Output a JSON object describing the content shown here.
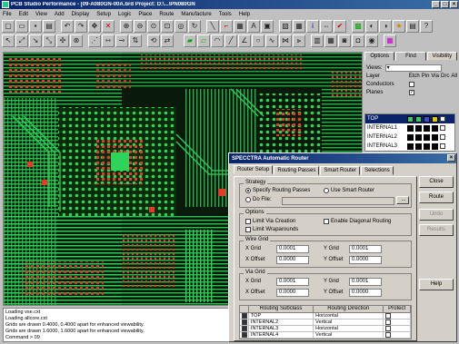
{
  "window": {
    "title": "PCB Studio Performance - [09-A080GN-00A.brd  Project: D:\\...\\PN080GN"
  },
  "menu": [
    "File",
    "Edit",
    "View",
    "Add",
    "Display",
    "Setup",
    "Logic",
    "Place",
    "Route",
    "Manufacture",
    "Tools",
    "Help"
  ],
  "panel": {
    "tabs": [
      "Options",
      "Find",
      "Visibility"
    ],
    "views_label": "Views:",
    "layer_label": "Layer",
    "col_headers": [
      "Etch",
      "Pin",
      "Via",
      "Drc",
      "All"
    ],
    "conductors_label": "Conductors",
    "planes_label": "Planes",
    "layers": [
      {
        "name": "TOP",
        "color": "#33cc66"
      },
      {
        "name": "INTERNAL1",
        "color": "#000000"
      },
      {
        "name": "INTERNAL2",
        "color": "#000000"
      },
      {
        "name": "INTERNAL3",
        "color": "#000000"
      }
    ]
  },
  "status": [
    "Loading vse.cxt",
    "Loading allcore.cxt",
    "Grids are drawn 0.4000, 0.4000 apart for enhanced viewability.",
    "Grids are drawn 1.6000, 1.6000 apart for enhanced viewability.",
    "Command > 09"
  ],
  "dialog": {
    "title": "SPECCTRA Automatic Router",
    "tabs": [
      "Router Setup",
      "Routing Passes",
      "Smart Router",
      "Selections"
    ],
    "strategy_label": "Strategy",
    "specify_label": "Specify Routing Passes",
    "smart_label": "Use Smart Router",
    "dofile_label": "Do File:",
    "browse_label": "...",
    "options_label": "Options",
    "limit_via_label": "Limit Via Creation",
    "diagonal_label": "Enable Diagonal Routing",
    "wraparounds_label": "Limit Wraparounds",
    "wire_grid_label": "Wire Grid",
    "via_grid_label": "Via Grid",
    "xgrid_label": "X Grid",
    "ygrid_label": "Y Grid",
    "xoffset_label": "X Offset",
    "yoffset_label": "Y Offset",
    "wire": {
      "xgrid": "0.0001",
      "ygrid": "0.0001",
      "xoffset": "0.0000",
      "yoffset": "0.0000"
    },
    "via": {
      "xgrid": "0.0001",
      "ygrid": "0.0001",
      "xoffset": "0.0000",
      "yoffset": "0.0000"
    },
    "grid_headers": [
      "Routing Subclass",
      "Routing Direction",
      "Protect"
    ],
    "grid_rows": [
      {
        "subclass": "TOP",
        "direction": "Horizontal"
      },
      {
        "subclass": "INTERNAL2",
        "direction": "Vertical"
      },
      {
        "subclass": "INTERNAL3",
        "direction": "Horizontal"
      },
      {
        "subclass": "INTERNAL4",
        "direction": "Vertical"
      }
    ],
    "buttons": {
      "close": "Close",
      "route": "Route",
      "undo": "Undo",
      "results": "Results",
      "help": "Help"
    }
  }
}
